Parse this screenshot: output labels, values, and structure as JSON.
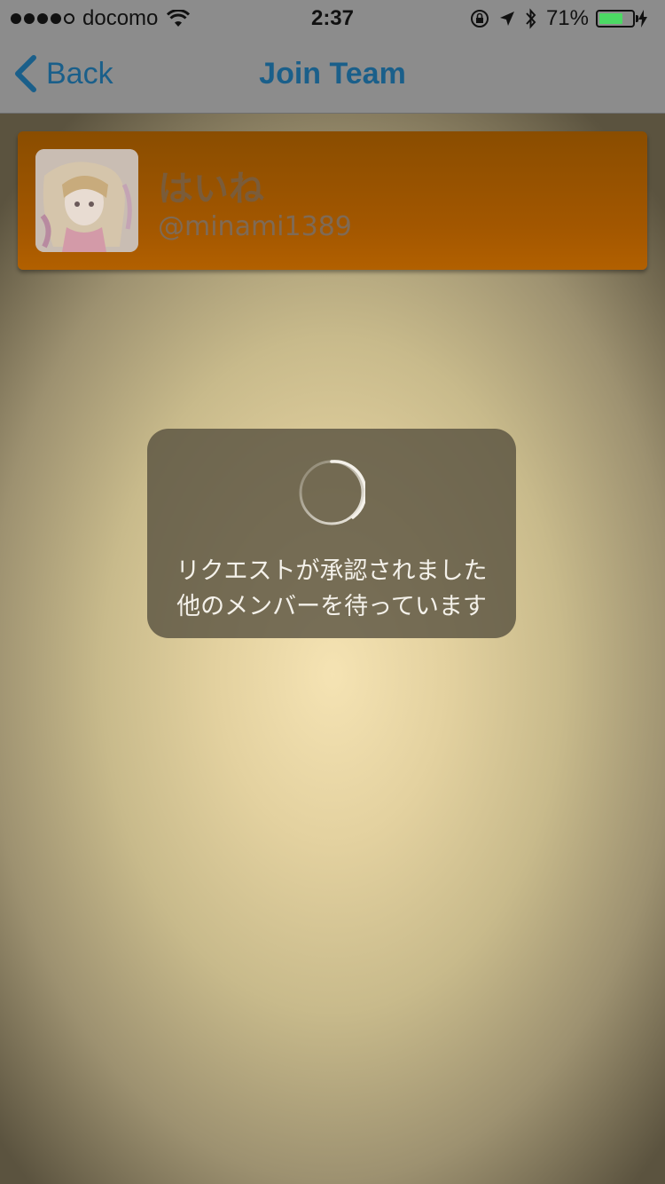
{
  "status_bar": {
    "carrier": "docomo",
    "time": "2:37",
    "battery_percent": "71%",
    "battery_level": 0.71
  },
  "nav": {
    "back_label": "Back",
    "title": "Join Team"
  },
  "user": {
    "name": "はいね",
    "handle": "@minami1389"
  },
  "hud": {
    "line1": "リクエストが承認されました",
    "line2": "他のメンバーを待っています"
  },
  "colors": {
    "nav_tint": "#1a5f8a",
    "card_orange": "#a35700",
    "battery_green": "#4cd964"
  }
}
